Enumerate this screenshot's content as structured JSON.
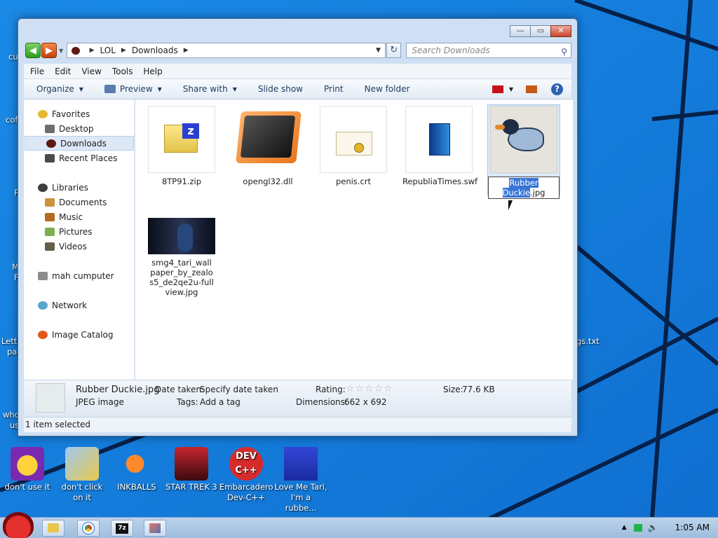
{
  "desktop": {
    "icons": [
      {
        "label": "don't use it",
        "color": "#6a2aa6"
      },
      {
        "label": "don't click on it",
        "color": "#d6c35a"
      },
      {
        "label": "INKBALLS",
        "color": "#e4621b"
      },
      {
        "label": "STAR TREK 3",
        "color": "#b21d2b"
      },
      {
        "label": "Embarcadero Dev-C++",
        "color": "#d3232a"
      },
      {
        "label": "Love Me Tari, I'm a rubbe...",
        "color": "#2c3fd0"
      }
    ],
    "edge_labels": {
      "cu": "cu",
      "cof": "cof",
      "p": "P",
      "m": "M",
      "f": "F",
      "letter": "Lette",
      "pai": "pai",
      "who": "who",
      "us": "us",
      "gs": "gs.txt"
    }
  },
  "window": {
    "breadcrumb": [
      "LOL",
      "Downloads"
    ],
    "search_placeholder": "Search Downloads",
    "menu": [
      "File",
      "Edit",
      "View",
      "Tools",
      "Help"
    ],
    "toolbar": {
      "organize": "Organize",
      "preview": "Preview",
      "share": "Share with",
      "slideshow": "Slide show",
      "print": "Print",
      "newfolder": "New folder"
    },
    "nav": {
      "favorites": "Favorites",
      "desktop": "Desktop",
      "downloads": "Downloads",
      "recent": "Recent Places",
      "libraries": "Libraries",
      "documents": "Documents",
      "music": "Music",
      "pictures": "Pictures",
      "videos": "Videos",
      "computer": "mah cumputer",
      "network": "Network",
      "catalog": "Image Catalog"
    },
    "files": [
      {
        "name": "8TP91.zip"
      },
      {
        "name": "opengl32.dll"
      },
      {
        "name": "penis.crt"
      },
      {
        "name": "RepubliaTimes.swf"
      },
      {
        "name_sel": "Rubber Duckie",
        "name_ext": ".jpg"
      },
      {
        "name": "smg4_tari_wallpaper_by_zealos5_de2qe2u-fullview.jpg"
      }
    ],
    "details": {
      "name": "Rubber Duckie.jpg",
      "type": "JPEG image",
      "date_key": "Date taken:",
      "date_val": "Specify date taken",
      "tags_key": "Tags:",
      "tags_val": "Add a tag",
      "rating_key": "Rating:",
      "rating_stars": "☆☆☆☆☆",
      "dim_key": "Dimensions:",
      "dim_val": "662 x 692",
      "size_key": "Size:",
      "size_val": "77.6 KB"
    },
    "status": "1 item selected"
  },
  "taskbar": {
    "time": "1:05 AM",
    "zip": "7z"
  }
}
